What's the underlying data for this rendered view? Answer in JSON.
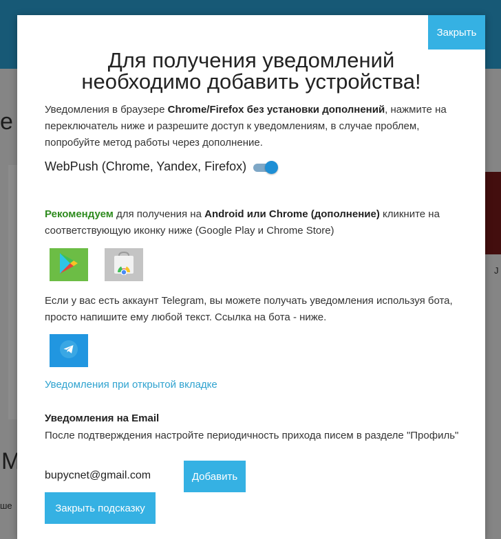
{
  "background": {
    "left_letter_top": "e",
    "left_letter_bottom": "M",
    "left_small_text": "ше",
    "right_letter": "J"
  },
  "modal": {
    "close_label": "Закрыть",
    "title_line1": "Для получения уведомлений",
    "title_line2": "необходимо добавить устройства!",
    "intro": {
      "part1": "Уведомления в браузере ",
      "bold": "Chrome/Firefox без установки дополнений",
      "part2": ", нажмите на переключатель ниже и разрешите доступ к уведомлениям, в случае проблем, попробуйте метод работы через дополнение."
    },
    "webpush_label": "WebPush (Chrome, Yandex, Firefox)",
    "webpush_enabled": true,
    "recommend": {
      "green": "Рекомендуем",
      "part1": " для получения на ",
      "bold": "Android или Chrome (дополнение)",
      "part2": " кликните на соответствующую иконку ниже (Google Play и Chrome Store)"
    },
    "icons": {
      "google_play": "google-play-icon",
      "chrome_store": "chrome-web-store-icon",
      "telegram": "telegram-icon"
    },
    "telegram_text": "Если у вас есть аккаунт Telegram, вы можете получать уведомления используя бота, просто напишите ему любой текст. Ссылка на бота - ниже.",
    "open_tab_link": "Уведомления при открытой вкладке",
    "email_heading": "Уведомления на Email",
    "email_desc": "После подтверждения настройте периодичность прихода писем в разделе \"Профиль\"",
    "email_value": "bupycnet@gmail.com",
    "add_label": "Добавить",
    "hint_close_label": "Закрыть подсказку"
  },
  "colors": {
    "accent": "#35b1e3",
    "recommend_green": "#2e8b1e",
    "link": "#2ea2cf"
  }
}
